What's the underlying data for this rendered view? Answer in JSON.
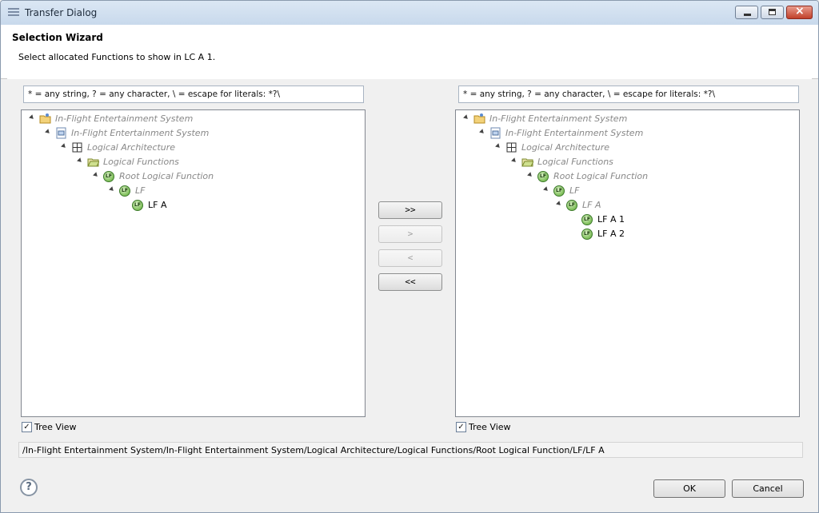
{
  "window": {
    "title": "Transfer Dialog"
  },
  "wizard": {
    "title": "Selection Wizard",
    "description": "Select allocated Functions to show in LC A 1."
  },
  "left": {
    "filter_value": "* = any string, ? = any character, \\ = escape for literals: *?\\",
    "nodes": [
      {
        "label": "In-Flight Entertainment System",
        "icon": "project-folder-icon"
      },
      {
        "label": "In-Flight Entertainment System",
        "icon": "system-model-icon"
      },
      {
        "label": "Logical Architecture",
        "icon": "architecture-grid-icon"
      },
      {
        "label": "Logical Functions",
        "icon": "folder-icon"
      },
      {
        "label": "Root Logical Function",
        "icon": "logical-function-icon"
      },
      {
        "label": "LF",
        "icon": "logical-function-icon"
      },
      {
        "label": "LF A",
        "icon": "logical-function-icon"
      }
    ],
    "tree_view_label": "Tree View",
    "tree_view_checked": true
  },
  "right": {
    "filter_value": "* = any string, ? = any character, \\ = escape for literals: *?\\",
    "nodes": [
      {
        "label": "In-Flight Entertainment System",
        "icon": "project-folder-icon"
      },
      {
        "label": "In-Flight Entertainment System",
        "icon": "system-model-icon"
      },
      {
        "label": "Logical Architecture",
        "icon": "architecture-grid-icon"
      },
      {
        "label": "Logical Functions",
        "icon": "folder-icon"
      },
      {
        "label": "Root Logical Function",
        "icon": "logical-function-icon"
      },
      {
        "label": "LF",
        "icon": "logical-function-icon"
      },
      {
        "label": "LF A",
        "icon": "logical-function-icon"
      },
      {
        "label": "LF A 1",
        "icon": "logical-function-icon"
      },
      {
        "label": "LF A 2",
        "icon": "logical-function-icon"
      }
    ],
    "tree_view_label": "Tree View",
    "tree_view_checked": true
  },
  "transfer": {
    "add_all": ">>",
    "add": ">",
    "remove": "<",
    "remove_all": "<<"
  },
  "selected_path": "/In-Flight Entertainment System/In-Flight Entertainment System/Logical Architecture/Logical Functions/Root Logical Function/LF/LF A",
  "footer": {
    "help_glyph": "?",
    "ok_label": "OK",
    "cancel_label": "Cancel"
  },
  "icons": {
    "check": "✓",
    "lf_badge": "LF"
  }
}
